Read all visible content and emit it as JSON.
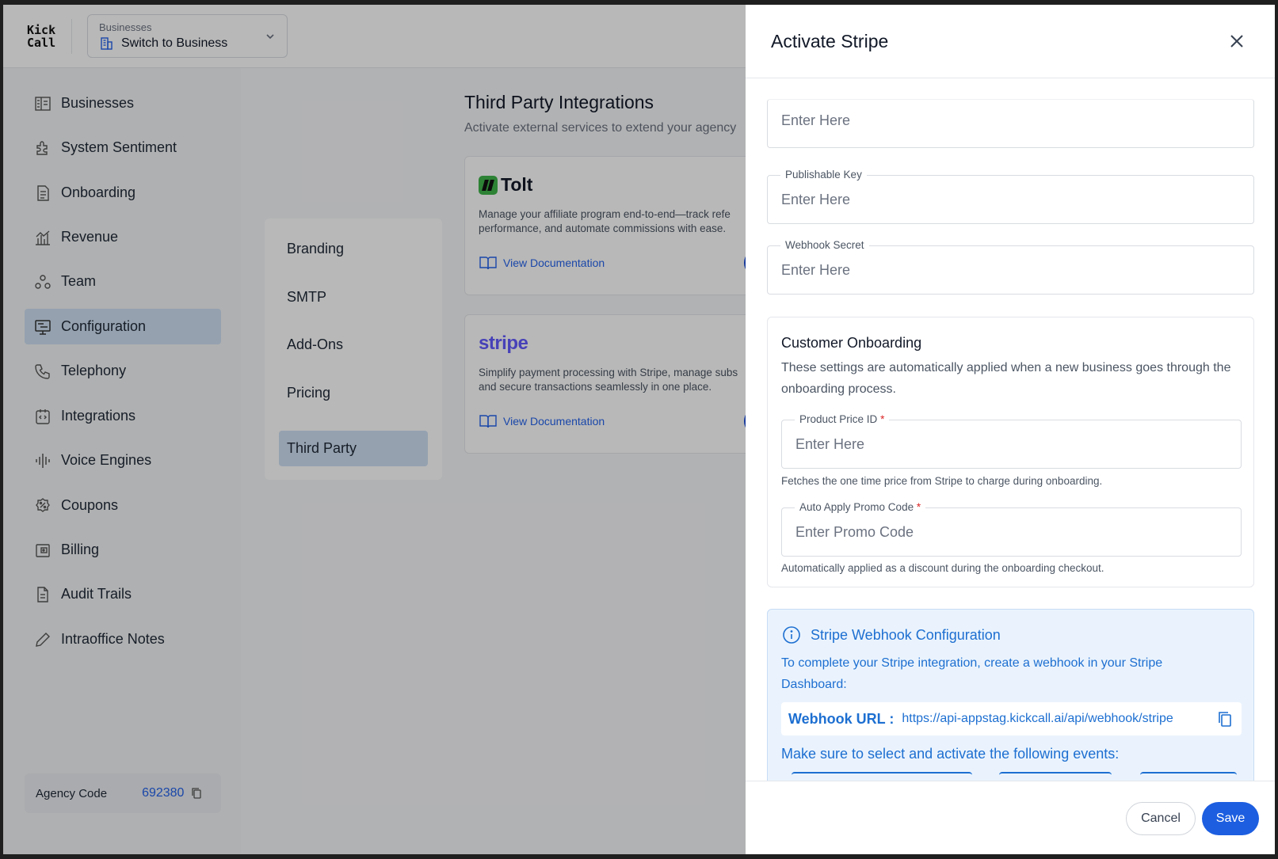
{
  "app": {
    "logo_line1": "Kick",
    "logo_line2": "Call"
  },
  "business_switcher": {
    "caption": "Businesses",
    "value": "Switch to Business"
  },
  "sidebar": {
    "items": [
      {
        "label": "Businesses",
        "icon": "building-list-icon"
      },
      {
        "label": "System Sentiment",
        "icon": "puzzle-icon"
      },
      {
        "label": "Onboarding",
        "icon": "document-icon"
      },
      {
        "label": "Revenue",
        "icon": "chart-icon"
      },
      {
        "label": "Team",
        "icon": "team-icon"
      },
      {
        "label": "Configuration",
        "icon": "config-icon",
        "active": true
      },
      {
        "label": "Telephony",
        "icon": "phone-icon"
      },
      {
        "label": "Integrations",
        "icon": "integration-icon"
      },
      {
        "label": "Voice Engines",
        "icon": "waveform-icon"
      },
      {
        "label": "Coupons",
        "icon": "badge-icon"
      },
      {
        "label": "Billing",
        "icon": "wallet-icon"
      },
      {
        "label": "Audit Trails",
        "icon": "file-icon"
      },
      {
        "label": "Intraoffice Notes",
        "icon": "pencil-icon"
      }
    ],
    "agency_label": "Agency Code",
    "agency_code": "692380"
  },
  "subnav": {
    "items": [
      {
        "label": "Branding"
      },
      {
        "label": "SMTP"
      },
      {
        "label": "Add-Ons"
      },
      {
        "label": "Pricing"
      },
      {
        "label": "Third Party",
        "active": true
      }
    ]
  },
  "content": {
    "title": "Third Party Integrations",
    "description": "Activate external services to extend your agency",
    "cards": [
      {
        "name": "Tolt",
        "description_line1": "Manage your affiliate program end-to-end—track refe",
        "description_line2": "performance, and automate commissions with ease.",
        "doc_link": "View Documentation"
      },
      {
        "name": "stripe",
        "description_line1": "Simplify payment processing with Stripe, manage subs",
        "description_line2": "and secure transactions seamlessly in one place.",
        "doc_link": "View Documentation"
      }
    ]
  },
  "drawer": {
    "title": "Activate Stripe",
    "fields": {
      "secret_key": {
        "placeholder": "Enter Here",
        "value": ""
      },
      "publishable_key": {
        "label": "Publishable Key",
        "placeholder": "Enter Here",
        "value": ""
      },
      "webhook_secret": {
        "label": "Webhook Secret",
        "placeholder": "Enter Here",
        "value": ""
      }
    },
    "onboarding": {
      "title": "Customer Onboarding",
      "description": "These settings are automatically applied when a new business goes through the onboarding process.",
      "product_price": {
        "label": "Product Price ID",
        "required_mark": "*",
        "placeholder": "Enter Here",
        "help": "Fetches the one time price from Stripe to charge during onboarding."
      },
      "promo_code": {
        "label": "Auto Apply Promo Code",
        "required_mark": "*",
        "placeholder": "Enter Promo Code",
        "help": "Automatically applied as a discount during the onboarding checkout."
      }
    },
    "webhook": {
      "title": "Stripe Webhook Configuration",
      "description": "To complete your Stripe integration, create a webhook in your Stripe Dashboard:",
      "url_label": "Webhook URL :",
      "url": "https://api-appstag.kickcall.ai/api/webhook/stripe",
      "events_text": "Make sure to select and activate the following events:"
    },
    "cancel_label": "Cancel",
    "save_label": "Save"
  },
  "colors": {
    "accent": "#1d5ee0",
    "active_nav": "#cfe0f3",
    "info_bg": "#eaf3fd",
    "info_text": "#1d6fd1",
    "required": "#dc2626",
    "tolt_green": "#3fb54a",
    "stripe_purple": "#635bff"
  }
}
